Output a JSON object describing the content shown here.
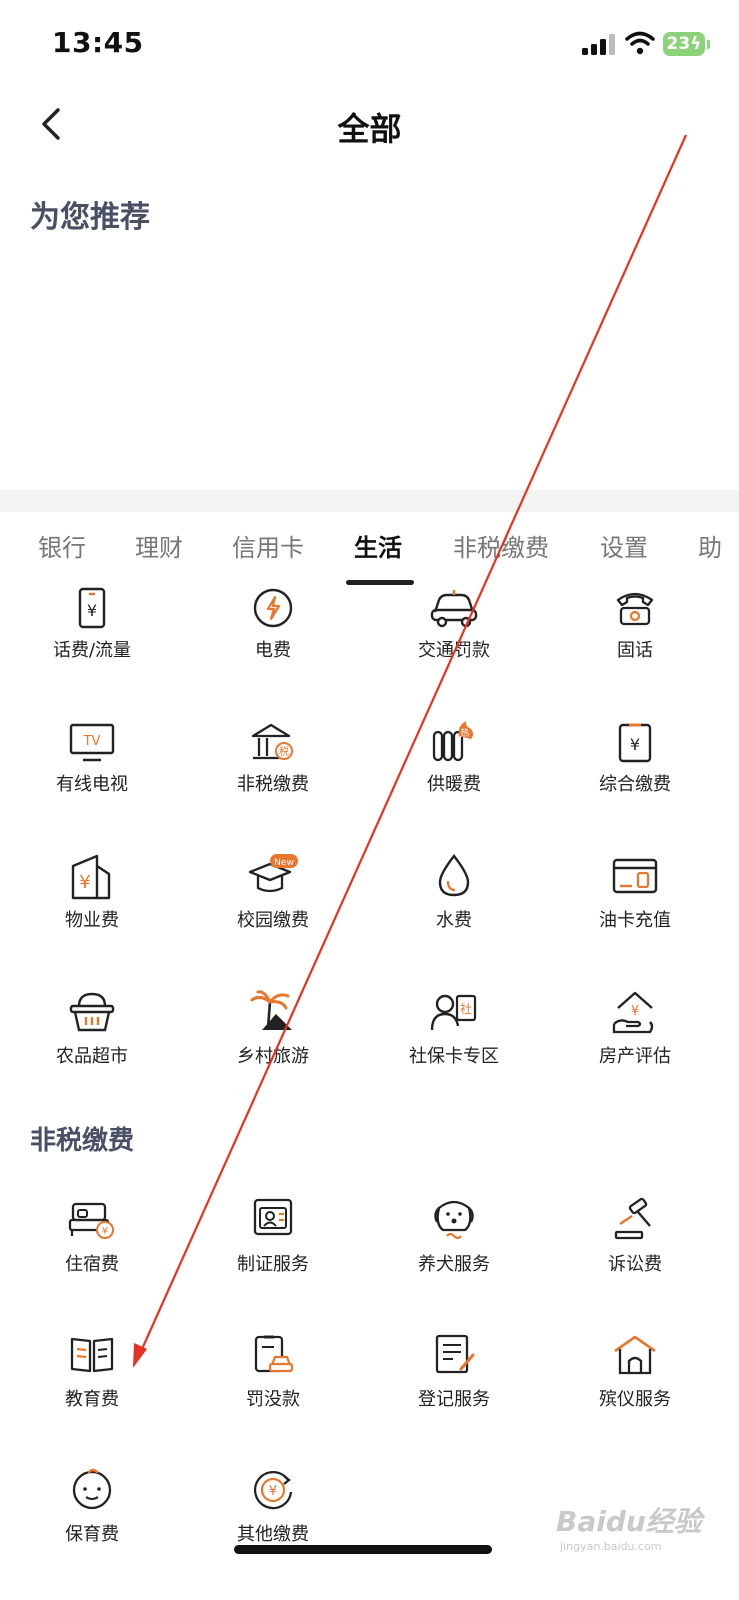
{
  "status_bar": {
    "time": "13:45",
    "battery": "23"
  },
  "nav": {
    "back_icon": "chevron-left-icon",
    "title": "全部"
  },
  "recommend": {
    "heading": "为您推荐"
  },
  "tabs": [
    {
      "label": "银行",
      "active": false
    },
    {
      "label": "理财",
      "active": false
    },
    {
      "label": "信用卡",
      "active": false
    },
    {
      "label": "生活",
      "active": true
    },
    {
      "label": "非税缴费",
      "active": false
    },
    {
      "label": "设置",
      "active": false
    },
    {
      "label": "助",
      "active": false
    }
  ],
  "life_items": [
    {
      "label": "话费/流量",
      "icon": "phone-bill-icon"
    },
    {
      "label": "电费",
      "icon": "electricity-icon"
    },
    {
      "label": "交通罚款",
      "icon": "car-icon"
    },
    {
      "label": "固话",
      "icon": "telephone-icon"
    },
    {
      "label": "有线电视",
      "icon": "tv-icon"
    },
    {
      "label": "非税缴费",
      "icon": "tax-building-icon"
    },
    {
      "label": "供暖费",
      "icon": "radiator-icon",
      "badge": "热"
    },
    {
      "label": "综合缴费",
      "icon": "clipboard-yuan-icon"
    },
    {
      "label": "物业费",
      "icon": "property-icon"
    },
    {
      "label": "校园缴费",
      "icon": "graduation-cap-icon",
      "badge": "New"
    },
    {
      "label": "水费",
      "icon": "water-drop-icon"
    },
    {
      "label": "油卡充值",
      "icon": "fuel-card-icon"
    },
    {
      "label": "农品超市",
      "icon": "basket-icon"
    },
    {
      "label": "乡村旅游",
      "icon": "palm-tree-icon"
    },
    {
      "label": "社保卡专区",
      "icon": "social-security-icon",
      "badge": "社"
    },
    {
      "label": "房产评估",
      "icon": "house-yuan-icon"
    }
  ],
  "nontax": {
    "heading": "非税缴费",
    "items": [
      {
        "label": "住宿费",
        "icon": "bed-icon"
      },
      {
        "label": "制证服务",
        "icon": "id-card-icon"
      },
      {
        "label": "养犬服务",
        "icon": "dog-icon"
      },
      {
        "label": "诉讼费",
        "icon": "gavel-icon"
      },
      {
        "label": "教育费",
        "icon": "open-book-icon"
      },
      {
        "label": "罚没款",
        "icon": "clipboard-car-icon"
      },
      {
        "label": "登记服务",
        "icon": "document-pen-icon"
      },
      {
        "label": "殡仪服务",
        "icon": "funeral-house-icon"
      },
      {
        "label": "保育费",
        "icon": "baby-face-icon"
      },
      {
        "label": "其他缴费",
        "icon": "circle-yuan-icon"
      }
    ]
  },
  "colors": {
    "accent": "#e8762c",
    "line": "#222222",
    "annotation_arrow": "#e53323"
  },
  "watermark": {
    "brand": "Baidu经验",
    "url": "jingyan.baidu.com"
  }
}
